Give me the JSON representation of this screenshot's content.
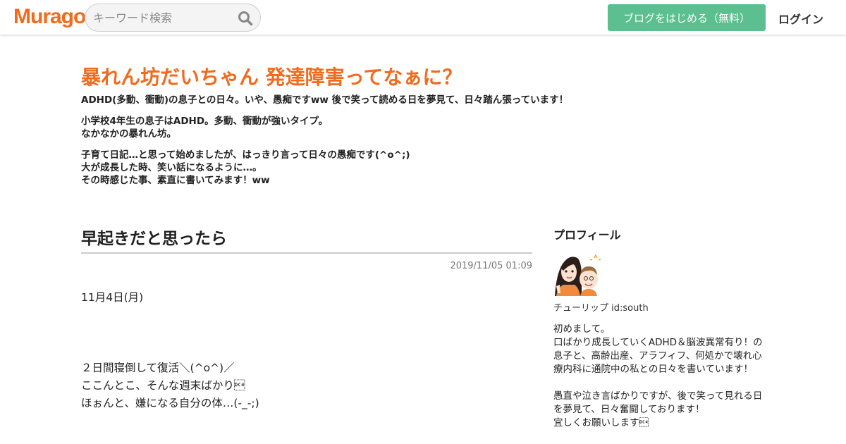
{
  "header": {
    "logo": "Muragon",
    "search_placeholder": "キーワード検索",
    "start_button": "ブログをはじめる（無料）",
    "login": "ログイン",
    "colors": {
      "brand": "#f26b1d",
      "start_button": "#5cbf8f"
    }
  },
  "blog": {
    "title": "暴れん坊だいちゃん 発達障害ってなぁに？",
    "tagline": "ADHD(多動、衝動)の息子との日々。いや、愚痴ですww  後で笑って読める日を夢見て、日々踏ん張っています！",
    "desc1": "小学校4年生の息子はADHD。多動、衝動が強いタイプ。\nなかなかの暴れん坊。",
    "desc2": "子育て日記…と思って始めましたが、はっきり言って日々の愚痴です(^o^;)\n大が成長した時、笑い話になるように…。\nその時感じた事、素直に書いてみます！ww"
  },
  "article": {
    "title": "早起きだと思ったら",
    "date": "2019/11/05 01:09",
    "body": "11月4日(月)\n\n\n\n２日間寝倒して復活＼(^o^)／\nここんとこ、そんな週末ばかり\u0014\nほぉんと、嫌になる自分の体…(-_-;)"
  },
  "sidebar": {
    "title": "プロフィール",
    "avatar": "profile-avatar",
    "name": "チューリップ   id:south",
    "text": "初めまして。\n口ばかり成長していくADHD＆脳波異常有り！の息子と、高齢出産、アラフィフ、何処かで壊れ心療内科に通院中の私との日々を書いています！\n\n愚直や泣き言ばかりですが、後で笑って見れる日を夢見て、日々奮闘しております！\n宜しくお願いします\u0014"
  }
}
